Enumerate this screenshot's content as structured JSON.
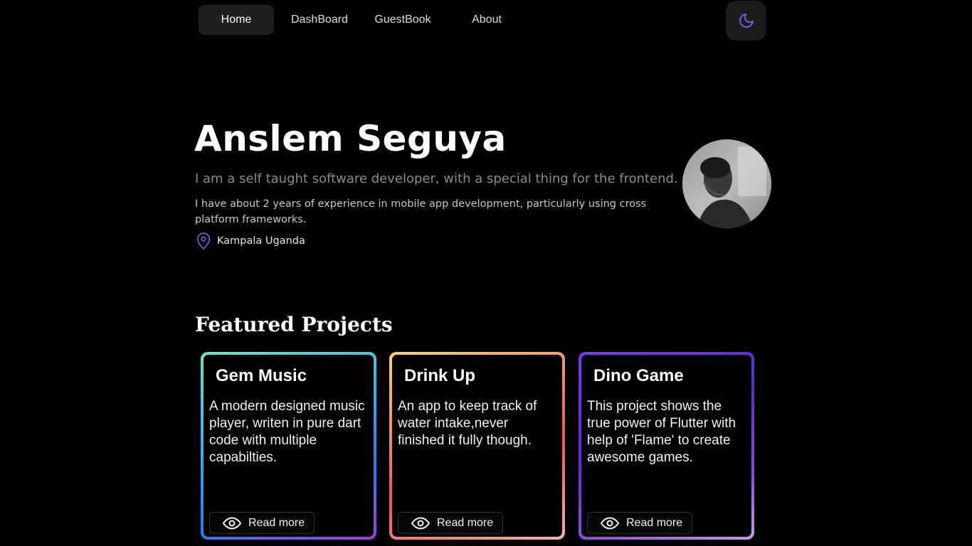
{
  "nav": {
    "items": [
      {
        "label": "Home"
      },
      {
        "label": "DashBoard"
      },
      {
        "label": "GuestBook"
      },
      {
        "label": "About"
      }
    ],
    "theme_icon": "moon-icon"
  },
  "hero": {
    "name": "Anslem Seguya",
    "tagline": "I am a self taught software developer, with a special thing for the frontend.",
    "bio": "I have about 2 years of experience in mobile app development, particularly using cross platform frameworks.",
    "location": "Kampala Uganda",
    "location_icon": "map-pin-icon"
  },
  "projects": {
    "title": "Featured Projects",
    "items": [
      {
        "title": "Gem Music",
        "description": "A modern designed music player, writen in pure dart code with multiple capabilties.",
        "read_more": "Read more"
      },
      {
        "title": "Drink Up",
        "description": "An app to keep track of water intake,never finished it fully though.",
        "read_more": "Read more"
      },
      {
        "title": "Dino Game",
        "description": "This project shows the true power of Flutter with help of 'Flame' to create awesome games.",
        "read_more": "Read more"
      }
    ]
  },
  "colors": {
    "accent": "#7b5ce0",
    "background": "#000000"
  }
}
